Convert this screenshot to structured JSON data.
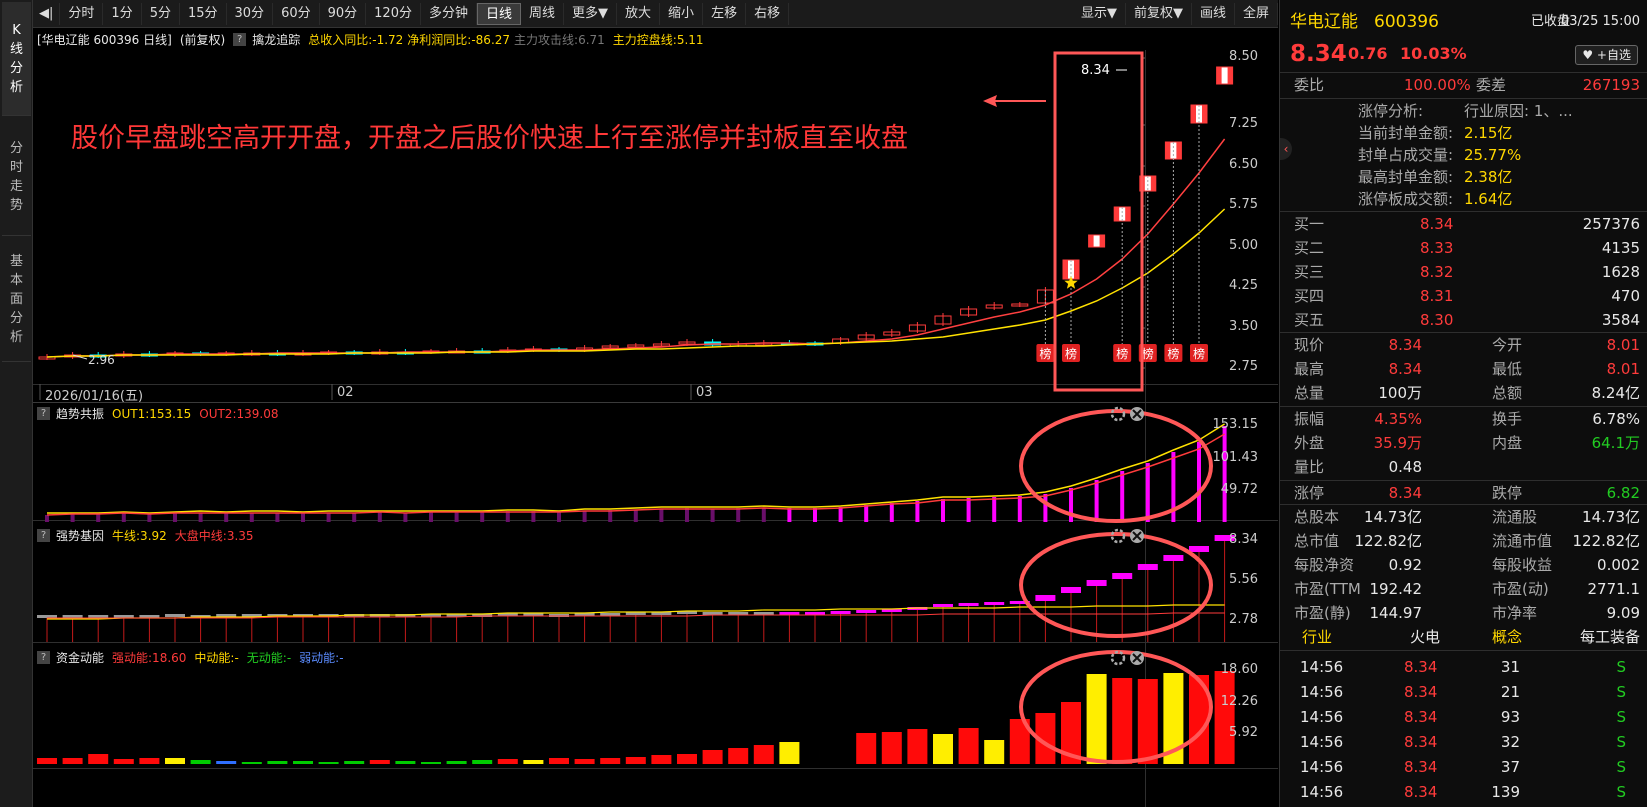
{
  "sidebar": {
    "tabs": [
      "K\n线\n分\n析",
      "分\n时\n走\n势",
      "基\n本\n面\n分\n析"
    ]
  },
  "toolbar": {
    "left": [
      "◀|",
      "分时",
      "1分",
      "5分",
      "15分",
      "30分",
      "60分",
      "90分",
      "120分",
      "多分钟",
      "日线",
      "周线",
      "更多▼",
      "放大",
      "缩小",
      "左移",
      "右移"
    ],
    "right": [
      "显示▼",
      "前复权▼",
      "画线",
      "全屏"
    ],
    "active": "日线"
  },
  "main": {
    "header": {
      "stock": "[华电辽能 600396 日线]",
      "adj": "(前复权)",
      "q": "?",
      "ind": "擒龙追踪",
      "rev": "总收入同比:-1.72",
      "profit": "净利润同比:-86.27",
      "attack": "主力攻击线:6.71",
      "control": "主力控盘线:5.11"
    },
    "yaxis": [
      "8.50",
      "7.25",
      "6.50",
      "5.75",
      "5.00",
      "4.25",
      "3.50",
      "2.75"
    ],
    "xaxis": [
      "2026/01/16(五)",
      "02",
      "03"
    ],
    "low_label": "2.96",
    "last_label": "8.34",
    "annotation": "股价早盘跳空高开开盘，开盘之后股价快速上行至涨停并封板直至收盘",
    "bang": "榜",
    "closes": [
      2.96,
      3.0,
      2.98,
      3.01,
      3.0,
      3.02,
      3.01,
      3.02,
      3.03,
      3.02,
      3.03,
      3.04,
      3.03,
      3.05,
      3.04,
      3.06,
      3.07,
      3.06,
      3.09,
      3.1,
      3.08,
      3.12,
      3.15,
      3.17,
      3.2,
      3.24,
      3.18,
      3.2,
      3.22,
      3.21,
      3.2,
      3.28,
      3.36,
      3.42,
      3.55,
      3.72,
      3.85,
      3.92,
      3.93,
      4.2,
      4.75,
      5.22,
      5.74,
      6.31,
      6.94,
      7.63,
      8.34
    ],
    "limit_up": [
      false,
      false,
      false,
      false,
      false,
      false,
      false,
      false,
      false,
      false,
      false,
      false,
      false,
      false,
      false,
      false,
      false,
      false,
      false,
      false,
      false,
      false,
      false,
      false,
      false,
      false,
      false,
      false,
      false,
      false,
      false,
      false,
      false,
      false,
      false,
      false,
      false,
      false,
      false,
      false,
      true,
      true,
      true,
      true,
      true,
      true,
      true
    ],
    "bang_idx": [
      39,
      40,
      42,
      43,
      44,
      45
    ],
    "colors": {
      "up": "#ff3b3b",
      "down": "#00ffff",
      "ma_fast": "#ff4040",
      "ma_slow": "#ffe100",
      "magenta": "#ff00ff",
      "circle": "#ff5757"
    }
  },
  "ind1": {
    "q": "?",
    "name": "趋势共振",
    "out1": "OUT1:153.15",
    "out2": "OUT2:139.08",
    "yaxis": [
      "153.15",
      "101.43",
      "49.72"
    ],
    "values": [
      12,
      13,
      13,
      14,
      13,
      14,
      15,
      14,
      15,
      15,
      14,
      15,
      15,
      16,
      15,
      16,
      16,
      16,
      17,
      17,
      16,
      18,
      19,
      20,
      21,
      22,
      21,
      22,
      23,
      22,
      22,
      24,
      27,
      30,
      33,
      37,
      38,
      40,
      41,
      45,
      55,
      68,
      82,
      95,
      112,
      128,
      153
    ]
  },
  "ind2": {
    "q": "?",
    "name": "强势基因",
    "bull": "牛线:3.92",
    "mid": "大盘中线:3.35",
    "yaxis": [
      "8.34",
      "5.56",
      "2.78"
    ]
  },
  "ind3": {
    "q": "?",
    "name": "资金动能",
    "strong": "强动能:18.60",
    "midv": "中动能:-",
    "none": "无动能:-",
    "weak": "弱动能:-",
    "yaxis": [
      "18.60",
      "12.26",
      "5.92"
    ],
    "values": [
      1.2,
      1.3,
      2.0,
      1.1,
      1.3,
      1.2,
      0.8,
      0.6,
      0.5,
      0.7,
      0.6,
      0.5,
      0.6,
      0.8,
      0.7,
      0.5,
      0.6,
      0.9,
      1.0,
      0.9,
      1.2,
      1.1,
      1.3,
      1.5,
      1.8,
      2.0,
      2.8,
      3.2,
      3.8,
      4.5,
      0,
      0,
      6.2,
      6.4,
      7.0,
      6.0,
      7.2,
      4.8,
      9.0,
      10.3,
      12.5,
      18.0,
      17.2,
      17.0,
      18.2,
      17.8,
      18.6
    ],
    "colors": [
      "r",
      "r",
      "r",
      "r",
      "r",
      "y",
      "g",
      "b",
      "g",
      "g",
      "g",
      "g",
      "g",
      "r",
      "g",
      "g",
      "g",
      "g",
      "r",
      "y",
      "r",
      "r",
      "r",
      "r",
      "r",
      "r",
      "r",
      "r",
      "r",
      "y",
      "x",
      "x",
      "r",
      "r",
      "r",
      "y",
      "r",
      "y",
      "r",
      "r",
      "r",
      "y",
      "r",
      "r",
      "y",
      "r",
      "r"
    ]
  },
  "panel": {
    "name": "华电辽能",
    "code": "600396",
    "status": "已收盘",
    "datetime": "03/25 15:00",
    "price": "8.34",
    "change": "0.76",
    "pct": "10.03%",
    "watch": "♥ +自选",
    "wb_label": "委比",
    "wb": "100.00%",
    "wc_label": "委差",
    "wc": "267193",
    "limit_rows": [
      [
        "涨停分析:",
        "行业原因: 1、..."
      ],
      [
        "当前封单金额:",
        "2.15亿"
      ],
      [
        "封单占成交量:",
        "25.77%"
      ],
      [
        "最高封单金额:",
        "2.38亿"
      ],
      [
        "涨停板成交额:",
        "1.64亿"
      ]
    ],
    "bids": [
      [
        "买一",
        "8.34",
        "257376"
      ],
      [
        "买二",
        "8.33",
        "4135"
      ],
      [
        "买三",
        "8.32",
        "1628"
      ],
      [
        "买四",
        "8.31",
        "470"
      ],
      [
        "买五",
        "8.30",
        "3584"
      ]
    ],
    "q1": [
      [
        "现价",
        "8.34",
        "今开",
        "8.01"
      ],
      [
        "最高",
        "8.34",
        "最低",
        "8.01"
      ],
      [
        "总量",
        "100万",
        "总额",
        "8.24亿"
      ]
    ],
    "q2": [
      [
        "振幅",
        "4.35%",
        "换手",
        "6.78%"
      ],
      [
        "外盘",
        "35.9万",
        "内盘",
        "64.1万"
      ],
      [
        "量比",
        "0.48",
        "",
        ""
      ]
    ],
    "q3": [
      [
        "涨停",
        "8.34",
        "跌停",
        "6.82"
      ]
    ],
    "q4": [
      [
        "总股本",
        "14.73亿",
        "流通股",
        "14.73亿"
      ],
      [
        "总市值",
        "122.82亿",
        "流通市值",
        "122.82亿"
      ],
      [
        "每股净资",
        "0.92",
        "每股收益",
        "0.002"
      ],
      [
        "市盈(TTM",
        "192.42",
        "市盈(动)",
        "2771.1"
      ],
      [
        "市盈(静)",
        "144.97",
        "市净率",
        "9.09"
      ]
    ],
    "industry": [
      "行业",
      "火电",
      "概念",
      "每工装备"
    ],
    "ticks": [
      [
        "14:56",
        "8.34",
        "31",
        "S"
      ],
      [
        "14:56",
        "8.34",
        "21",
        "S"
      ],
      [
        "14:56",
        "8.34",
        "93",
        "S"
      ],
      [
        "14:56",
        "8.34",
        "32",
        "S"
      ],
      [
        "14:56",
        "8.34",
        "37",
        "S"
      ],
      [
        "14:56",
        "8.34",
        "139",
        "S"
      ]
    ]
  }
}
